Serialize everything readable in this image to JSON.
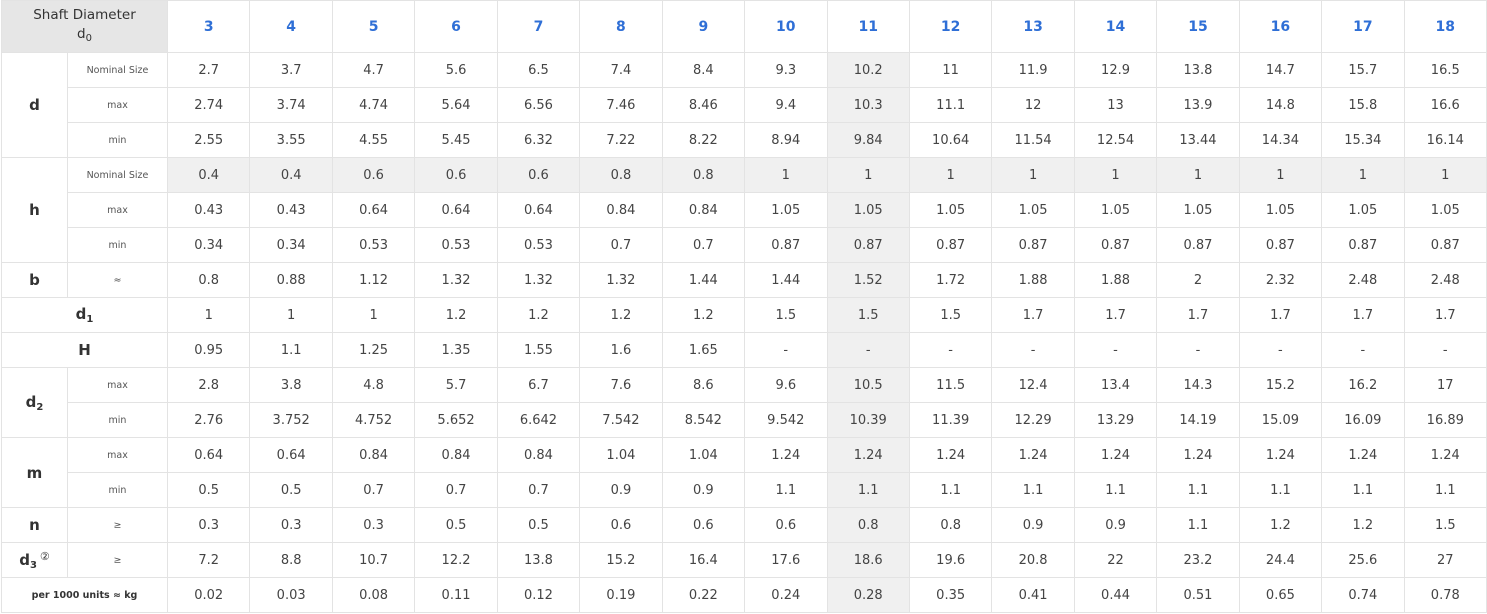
{
  "header": {
    "corner_line1": "Shaft Diameter",
    "corner_base": "d",
    "corner_sub": "0",
    "sizes": [
      "3",
      "4",
      "5",
      "6",
      "7",
      "8",
      "9",
      "10",
      "11",
      "12",
      "13",
      "14",
      "15",
      "16",
      "17",
      "18"
    ]
  },
  "groups": {
    "d": "d",
    "h": "h",
    "b": "b",
    "d1_base": "d",
    "d1_sub": "1",
    "H": "H",
    "d2_base": "d",
    "d2_sub": "2",
    "m": "m",
    "n": "n",
    "d3_base": "d",
    "d3_sub": "3",
    "d3_note": "②",
    "weight": "per 1000 units ≈ kg"
  },
  "sublabels": {
    "nominal": "Nominal Size",
    "max": "max",
    "min": "min",
    "approx": "≈",
    "gte": "≥"
  },
  "rows": {
    "d_nom": [
      "2.7",
      "3.7",
      "4.7",
      "5.6",
      "6.5",
      "7.4",
      "8.4",
      "9.3",
      "10.2",
      "11",
      "11.9",
      "12.9",
      "13.8",
      "14.7",
      "15.7",
      "16.5"
    ],
    "d_max": [
      "2.74",
      "3.74",
      "4.74",
      "5.64",
      "6.56",
      "7.46",
      "8.46",
      "9.4",
      "10.3",
      "11.1",
      "12",
      "13",
      "13.9",
      "14.8",
      "15.8",
      "16.6"
    ],
    "d_min": [
      "2.55",
      "3.55",
      "4.55",
      "5.45",
      "6.32",
      "7.22",
      "8.22",
      "8.94",
      "9.84",
      "10.64",
      "11.54",
      "12.54",
      "13.44",
      "14.34",
      "15.34",
      "16.14"
    ],
    "h_nom": [
      "0.4",
      "0.4",
      "0.6",
      "0.6",
      "0.6",
      "0.8",
      "0.8",
      "1",
      "1",
      "1",
      "1",
      "1",
      "1",
      "1",
      "1",
      "1"
    ],
    "h_max": [
      "0.43",
      "0.43",
      "0.64",
      "0.64",
      "0.64",
      "0.84",
      "0.84",
      "1.05",
      "1.05",
      "1.05",
      "1.05",
      "1.05",
      "1.05",
      "1.05",
      "1.05",
      "1.05"
    ],
    "h_min": [
      "0.34",
      "0.34",
      "0.53",
      "0.53",
      "0.53",
      "0.7",
      "0.7",
      "0.87",
      "0.87",
      "0.87",
      "0.87",
      "0.87",
      "0.87",
      "0.87",
      "0.87",
      "0.87"
    ],
    "b": [
      "0.8",
      "0.88",
      "1.12",
      "1.32",
      "1.32",
      "1.32",
      "1.44",
      "1.44",
      "1.52",
      "1.72",
      "1.88",
      "1.88",
      "2",
      "2.32",
      "2.48",
      "2.48"
    ],
    "d1": [
      "1",
      "1",
      "1",
      "1.2",
      "1.2",
      "1.2",
      "1.2",
      "1.5",
      "1.5",
      "1.5",
      "1.7",
      "1.7",
      "1.7",
      "1.7",
      "1.7",
      "1.7"
    ],
    "H": [
      "0.95",
      "1.1",
      "1.25",
      "1.35",
      "1.55",
      "1.6",
      "1.65",
      "-",
      "-",
      "-",
      "-",
      "-",
      "-",
      "-",
      "-",
      "-"
    ],
    "d2_max": [
      "2.8",
      "3.8",
      "4.8",
      "5.7",
      "6.7",
      "7.6",
      "8.6",
      "9.6",
      "10.5",
      "11.5",
      "12.4",
      "13.4",
      "14.3",
      "15.2",
      "16.2",
      "17"
    ],
    "d2_min": [
      "2.76",
      "3.752",
      "4.752",
      "5.652",
      "6.642",
      "7.542",
      "8.542",
      "9.542",
      "10.39",
      "11.39",
      "12.29",
      "13.29",
      "14.19",
      "15.09",
      "16.09",
      "16.89"
    ],
    "m_max": [
      "0.64",
      "0.64",
      "0.84",
      "0.84",
      "0.84",
      "1.04",
      "1.04",
      "1.24",
      "1.24",
      "1.24",
      "1.24",
      "1.24",
      "1.24",
      "1.24",
      "1.24",
      "1.24"
    ],
    "m_min": [
      "0.5",
      "0.5",
      "0.7",
      "0.7",
      "0.7",
      "0.9",
      "0.9",
      "1.1",
      "1.1",
      "1.1",
      "1.1",
      "1.1",
      "1.1",
      "1.1",
      "1.1",
      "1.1"
    ],
    "n": [
      "0.3",
      "0.3",
      "0.3",
      "0.5",
      "0.5",
      "0.6",
      "0.6",
      "0.6",
      "0.8",
      "0.8",
      "0.9",
      "0.9",
      "1.1",
      "1.2",
      "1.2",
      "1.5"
    ],
    "d3": [
      "7.2",
      "8.8",
      "10.7",
      "12.2",
      "13.8",
      "15.2",
      "16.4",
      "17.6",
      "18.6",
      "19.6",
      "20.8",
      "22",
      "23.2",
      "24.4",
      "25.6",
      "27"
    ],
    "weight": [
      "0.02",
      "0.03",
      "0.08",
      "0.11",
      "0.12",
      "0.19",
      "0.22",
      "0.24",
      "0.28",
      "0.35",
      "0.41",
      "0.44",
      "0.51",
      "0.65",
      "0.74",
      "0.78"
    ]
  },
  "colors": {
    "header_size": "#2f6fd6",
    "highlight": "#f0f0f0",
    "corner_bg": "#e6e6e6"
  }
}
